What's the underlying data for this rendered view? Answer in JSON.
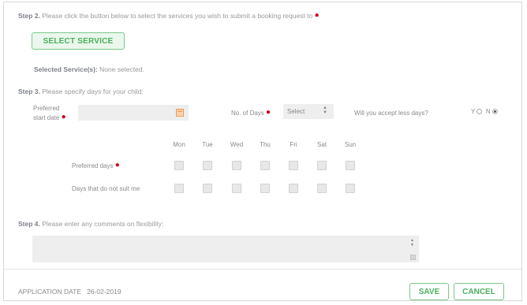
{
  "step2": {
    "label": "Step 2.",
    "text": "Please click the button below to select the services you wish to submit a booking request to",
    "button_label": "SELECT SERVICE",
    "selected_label": "Selected Service(s):",
    "selected_value": "None selected."
  },
  "step3": {
    "label": "Step 3.",
    "text": "Please specify days for your child:",
    "start_date_label_line1": "Preferred",
    "start_date_label_line2": "start date",
    "start_date_value": "",
    "days_label": "No. of Days",
    "days_select_value": "Select",
    "accept_less_label": "Will you accept less days?",
    "accept_yes": "Y",
    "accept_no": "N",
    "accept_selected": "N",
    "weekdays": [
      "Mon",
      "Tue",
      "Wed",
      "Thu",
      "Fri",
      "Sat",
      "Sun"
    ],
    "row_preferred": "Preferred days",
    "row_not_suit": "Days that do not suit me",
    "preferred_checked": [
      false,
      false,
      false,
      false,
      false,
      false,
      false
    ],
    "not_suit_checked": [
      false,
      false,
      false,
      false,
      false,
      false,
      false
    ]
  },
  "step4": {
    "label": "Step 4.",
    "text": "Please enter any comments on flexibility:",
    "comments_value": ""
  },
  "footer": {
    "app_date_label": "APPLICATION DATE",
    "app_date_value": "26-02-2019",
    "save_label": "SAVE",
    "cancel_label": "CANCEL"
  },
  "colors": {
    "accent_green": "#4caf5c",
    "required_red": "#d0021b",
    "calendar_orange": "#f29a56"
  },
  "icons": {
    "calendar": "calendar-icon",
    "select_caret": "chevron-down-icon"
  }
}
